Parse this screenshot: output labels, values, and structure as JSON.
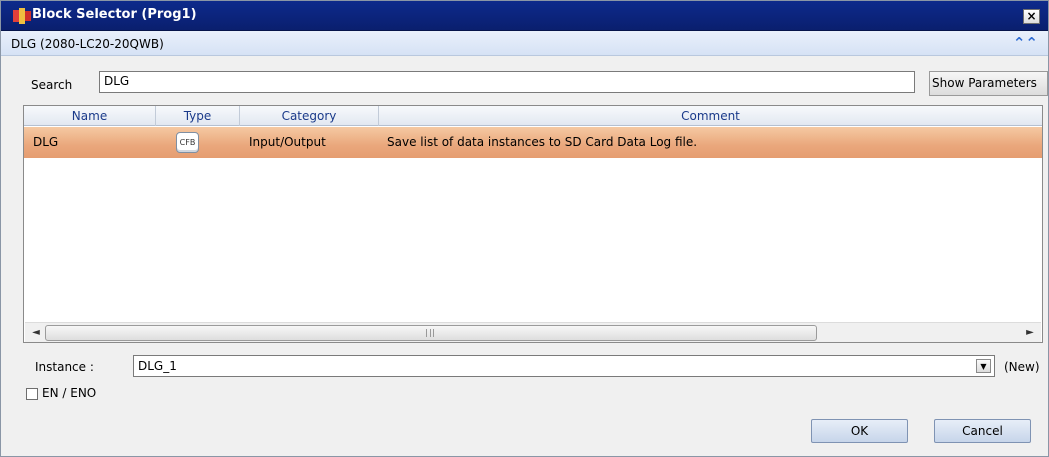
{
  "window": {
    "title": "Block Selector (Prog1)",
    "close_symbol": "×"
  },
  "section": {
    "header": "DLG (2080-LC20-20QWB)",
    "collapse_symbol": "«"
  },
  "search": {
    "label": "Search",
    "value": "DLG",
    "show_parameters_label": "Show Parameters"
  },
  "grid": {
    "columns": [
      "Name",
      "Type",
      "Category",
      "Comment"
    ],
    "rows": [
      {
        "name": "DLG",
        "type": "CFB",
        "category": "Input/Output",
        "comment": "Save list of data instances to SD Card Data Log file."
      }
    ],
    "selected_row_color": "#eaa77c",
    "scroll_left": "◄",
    "scroll_right": "►"
  },
  "instance": {
    "label": "Instance :",
    "value": "DLG_1",
    "dropdown_symbol": "▼",
    "new_label": "(New)"
  },
  "en_eno": {
    "label": "EN / ENO",
    "checked": false
  },
  "buttons": {
    "ok": "OK",
    "cancel": "Cancel"
  },
  "colors": {
    "titlebar": "#0d2a8c",
    "header_text": "#1a3a8a"
  },
  "icons": {
    "app": "block-selector-app-icon",
    "collapse": "double-chevron-up-icon",
    "type": "cfb-icon"
  }
}
